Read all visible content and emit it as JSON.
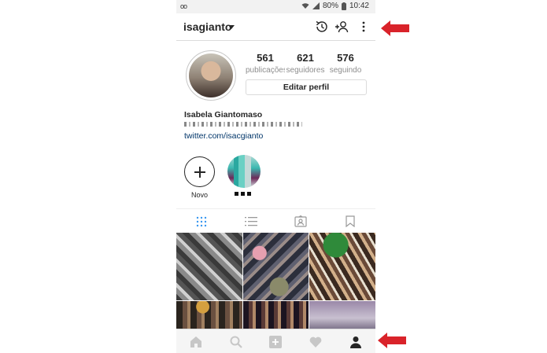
{
  "status_bar": {
    "voicemail": "oo",
    "battery": "80%",
    "time": "10:42"
  },
  "header": {
    "username": "isagianto",
    "icons": [
      "history-icon",
      "add-person-icon",
      "more-vertical-icon"
    ]
  },
  "profile": {
    "stats": [
      {
        "value": "561",
        "label": "publicações"
      },
      {
        "value": "621",
        "label": "seguidores"
      },
      {
        "value": "576",
        "label": "seguindo"
      }
    ],
    "edit_button": "Editar perfil",
    "full_name": "Isabela Giantomaso",
    "link": "twitter.com/isacgianto"
  },
  "stories": {
    "new_label": "Novo"
  },
  "tabs": [
    "grid-icon",
    "list-icon",
    "tagged-icon",
    "saved-icon"
  ],
  "bottom_nav": [
    "home-icon",
    "search-icon",
    "new-post-icon",
    "heart-icon",
    "profile-icon"
  ],
  "colors": {
    "arrow": "#d9232a",
    "active_tab": "#3897f0",
    "link": "#003569"
  }
}
